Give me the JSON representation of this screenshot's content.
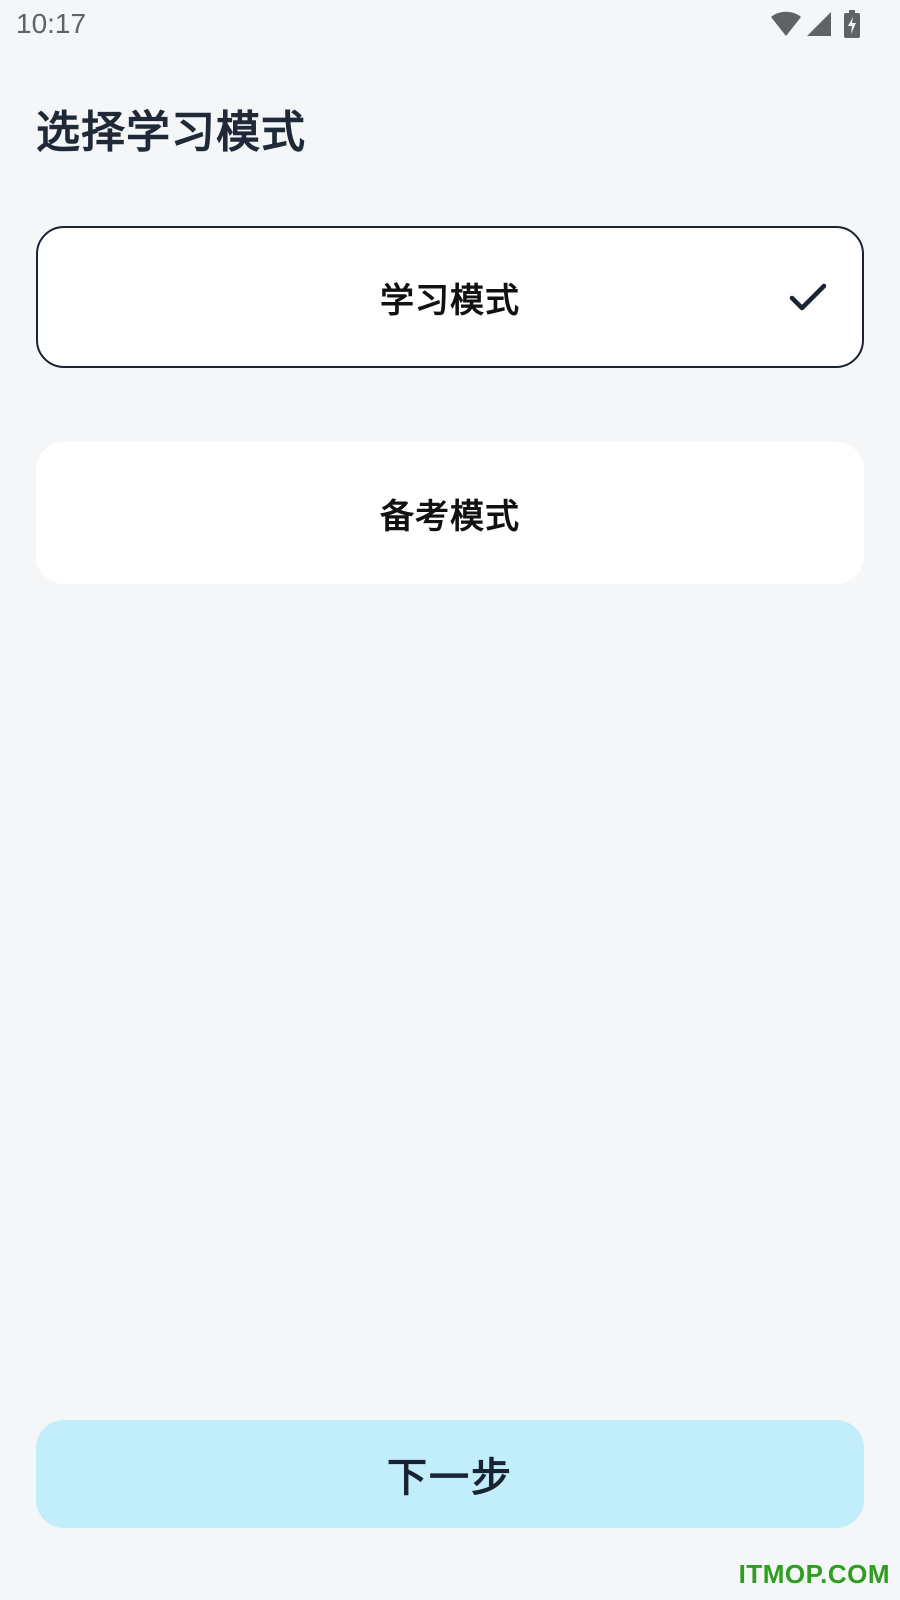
{
  "status_bar": {
    "time": "10:17",
    "icons": [
      "wifi-icon",
      "signal-icon",
      "battery-charging-icon"
    ]
  },
  "page": {
    "title": "选择学习模式"
  },
  "modes": [
    {
      "label": "学习模式",
      "selected": true
    },
    {
      "label": "备考模式",
      "selected": false
    }
  ],
  "actions": {
    "next_label": "下一步"
  },
  "watermark": {
    "text": "ITMOP.COM"
  },
  "colors": {
    "background": "#f5f6f8",
    "card": "#ffffff",
    "selected_border": "#1a2332",
    "button_bg": "#c2eefb",
    "watermark": "#2e9e1f"
  }
}
